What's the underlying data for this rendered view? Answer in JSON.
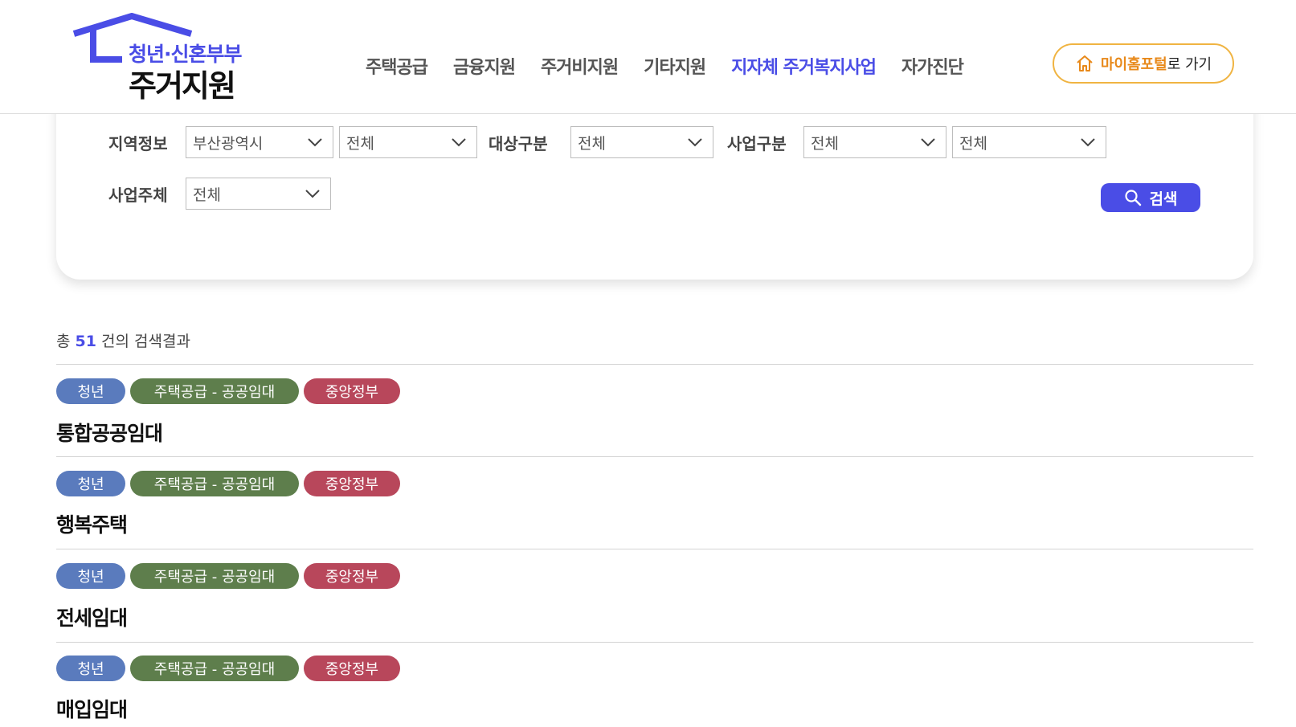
{
  "header": {
    "logo": {
      "line1": "청년·신혼부부",
      "line2": "주거지원"
    },
    "nav": [
      {
        "label": "주택공급",
        "active": false
      },
      {
        "label": "금융지원",
        "active": false
      },
      {
        "label": "주거비지원",
        "active": false
      },
      {
        "label": "기타지원",
        "active": false
      },
      {
        "label": "지자체 주거복지사업",
        "active": true
      },
      {
        "label": "자가진단",
        "active": false
      }
    ],
    "portal_button": {
      "accent": "마이홈포털",
      "rest": "로 가기",
      "icon": "home-icon"
    }
  },
  "filters": {
    "region_label": "지역정보",
    "region_city": "부산광역시",
    "region_district": "전체",
    "target_label": "대상구분",
    "target_value": "전체",
    "business_type_label": "사업구분",
    "business_type_value1": "전체",
    "business_type_value2": "전체",
    "operator_label": "사업주체",
    "operator_value": "전체",
    "search_button": "검색"
  },
  "results": {
    "count_prefix": "총",
    "count": "51",
    "count_suffix": "건의 검색결과",
    "items": [
      {
        "tags": [
          "청년",
          "주택공급 - 공공임대",
          "중앙정부"
        ],
        "title": "통합공공임대"
      },
      {
        "tags": [
          "청년",
          "주택공급 - 공공임대",
          "중앙정부"
        ],
        "title": "행복주택"
      },
      {
        "tags": [
          "청년",
          "주택공급 - 공공임대",
          "중앙정부"
        ],
        "title": "전세임대"
      },
      {
        "tags": [
          "청년",
          "주택공급 - 공공임대",
          "중앙정부"
        ],
        "title": "매입임대"
      }
    ]
  },
  "colors": {
    "primary": "#4a4de6",
    "portal_border": "#f0b442",
    "portal_accent": "#e8891a",
    "tag_youth": "#5a7bbd",
    "tag_category": "#5e7e4c",
    "tag_gov": "#b8475b"
  }
}
